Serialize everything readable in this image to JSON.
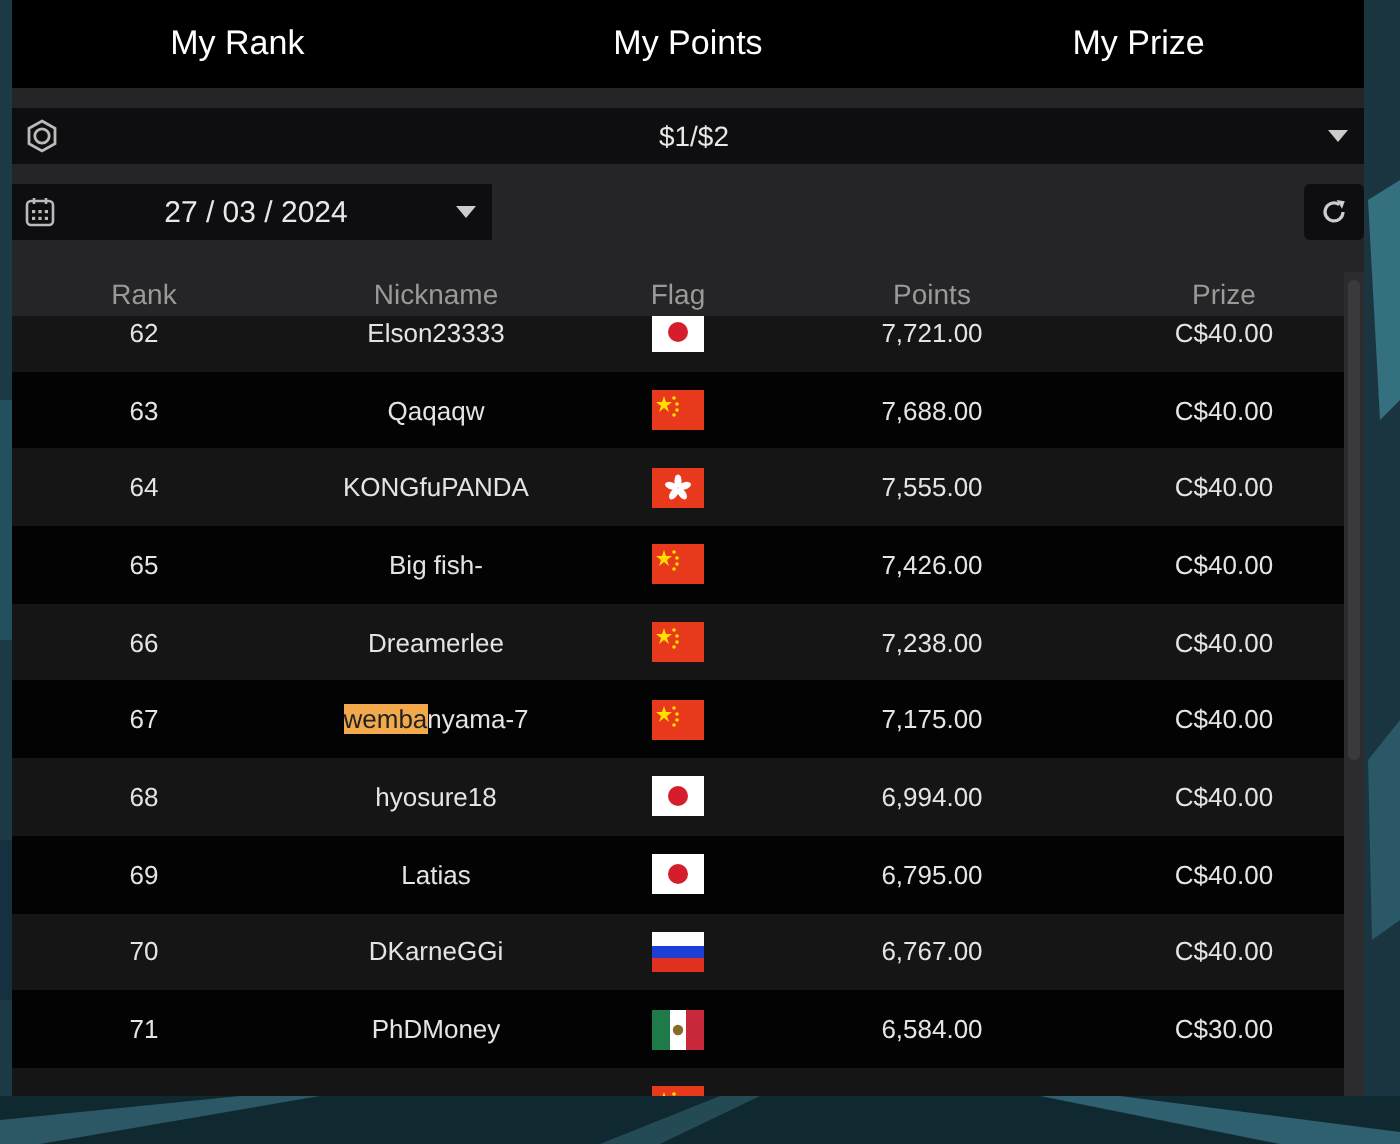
{
  "tabs": [
    {
      "label": "My Rank",
      "selected": false
    },
    {
      "label": "My Points",
      "selected": false
    },
    {
      "label": "My Prize",
      "selected": false
    }
  ],
  "stake_select": {
    "value": "$1/$2"
  },
  "date_picker": {
    "value": "27 / 03 / 2024"
  },
  "table": {
    "columns": [
      "Rank",
      "Nickname",
      "Flag",
      "Points",
      "Prize"
    ],
    "rows": [
      {
        "rank": "62",
        "nickname": [
          {
            "text": "Elson23333",
            "highlighted": false
          }
        ],
        "flag": {
          "kind": "japan"
        },
        "points": "7,721.00",
        "prize": "C$40.00"
      },
      {
        "rank": "63",
        "nickname": [
          {
            "text": "Qaqaqw",
            "highlighted": false
          }
        ],
        "flag": {
          "kind": "china"
        },
        "points": "7,688.00",
        "prize": "C$40.00"
      },
      {
        "rank": "64",
        "nickname": [
          {
            "text": "KONGfuPANDA",
            "highlighted": false
          }
        ],
        "flag": {
          "kind": "hong-kong"
        },
        "points": "7,555.00",
        "prize": "C$40.00"
      },
      {
        "rank": "65",
        "nickname": [
          {
            "text": "Big fish-",
            "highlighted": false
          }
        ],
        "flag": {
          "kind": "china"
        },
        "points": "7,426.00",
        "prize": "C$40.00"
      },
      {
        "rank": "66",
        "nickname": [
          {
            "text": "Dreamerlee",
            "highlighted": false
          }
        ],
        "flag": {
          "kind": "china"
        },
        "points": "7,238.00",
        "prize": "C$40.00"
      },
      {
        "rank": "67",
        "nickname": [
          {
            "text": "wemba",
            "highlighted": true
          },
          {
            "text": "nyama-7",
            "highlighted": false
          }
        ],
        "flag": {
          "kind": "china"
        },
        "points": "7,175.00",
        "prize": "C$40.00"
      },
      {
        "rank": "68",
        "nickname": [
          {
            "text": "hyosure18",
            "highlighted": false
          }
        ],
        "flag": {
          "kind": "japan"
        },
        "points": "6,994.00",
        "prize": "C$40.00"
      },
      {
        "rank": "69",
        "nickname": [
          {
            "text": "Latias",
            "highlighted": false
          }
        ],
        "flag": {
          "kind": "japan"
        },
        "points": "6,795.00",
        "prize": "C$40.00"
      },
      {
        "rank": "70",
        "nickname": [
          {
            "text": "DKarneGGi",
            "highlighted": false
          }
        ],
        "flag": {
          "kind": "russia"
        },
        "points": "6,767.00",
        "prize": "C$40.00"
      },
      {
        "rank": "71",
        "nickname": [
          {
            "text": "PhDMoney",
            "highlighted": false
          }
        ],
        "flag": {
          "kind": "mexico"
        },
        "points": "6,584.00",
        "prize": "C$30.00"
      },
      {
        "flag": {
          "kind": "china"
        }
      }
    ]
  }
}
